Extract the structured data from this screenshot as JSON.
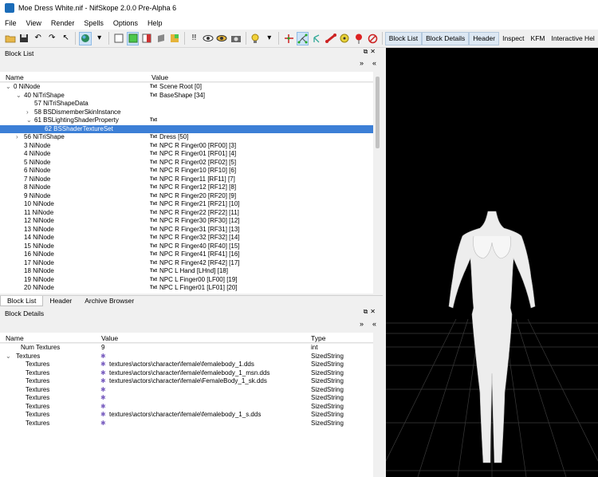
{
  "window": {
    "title": "Moe Dress White.nif - NifSkope 2.0.0 Pre-Alpha 6"
  },
  "menu": [
    "File",
    "View",
    "Render",
    "Spells",
    "Options",
    "Help"
  ],
  "toolbar": {
    "tabs": [
      {
        "label": "Block List",
        "selected": true
      },
      {
        "label": "Block Details",
        "selected": true
      },
      {
        "label": "Header",
        "selected": true
      },
      {
        "label": "Inspect",
        "selected": false
      },
      {
        "label": "KFM",
        "selected": false
      },
      {
        "label": "Interactive Hel",
        "selected": false
      }
    ]
  },
  "block_list": {
    "title": "Block List",
    "columns": [
      "Name",
      "Value"
    ],
    "rows": [
      {
        "indent": 0,
        "expander": "v",
        "name": "0 NiNode",
        "txt": "Txt",
        "value": "Scene Root [0]",
        "selected": false
      },
      {
        "indent": 1,
        "expander": "v",
        "name": "40 NiTriShape",
        "txt": "Txt",
        "value": "BaseShape [34]",
        "selected": false
      },
      {
        "indent": 2,
        "expander": "",
        "name": "57 NiTriShapeData",
        "txt": "",
        "value": "",
        "selected": false
      },
      {
        "indent": 2,
        "expander": ">",
        "name": "58 BSDismemberSkinInstance",
        "txt": "",
        "value": "",
        "selected": false
      },
      {
        "indent": 2,
        "expander": "v",
        "name": "61 BSLightingShaderProperty",
        "txt": "Txt",
        "value": "",
        "selected": false
      },
      {
        "indent": 3,
        "expander": "",
        "name": "62 BSShaderTextureSet",
        "txt": "",
        "value": "",
        "selected": true
      },
      {
        "indent": 1,
        "expander": ">",
        "name": "56 NiTriShape",
        "txt": "Txt",
        "value": "Dress [50]",
        "selected": false
      },
      {
        "indent": 1,
        "expander": "",
        "name": "3 NiNode",
        "txt": "Txt",
        "value": "NPC R Finger00 [RF00] [3]",
        "selected": false
      },
      {
        "indent": 1,
        "expander": "",
        "name": "4 NiNode",
        "txt": "Txt",
        "value": "NPC R Finger01 [RF01] [4]",
        "selected": false
      },
      {
        "indent": 1,
        "expander": "",
        "name": "5 NiNode",
        "txt": "Txt",
        "value": "NPC R Finger02 [RF02] [5]",
        "selected": false
      },
      {
        "indent": 1,
        "expander": "",
        "name": "6 NiNode",
        "txt": "Txt",
        "value": "NPC R Finger10 [RF10] [6]",
        "selected": false
      },
      {
        "indent": 1,
        "expander": "",
        "name": "7 NiNode",
        "txt": "Txt",
        "value": "NPC R Finger11 [RF11] [7]",
        "selected": false
      },
      {
        "indent": 1,
        "expander": "",
        "name": "8 NiNode",
        "txt": "Txt",
        "value": "NPC R Finger12 [RF12] [8]",
        "selected": false
      },
      {
        "indent": 1,
        "expander": "",
        "name": "9 NiNode",
        "txt": "Txt",
        "value": "NPC R Finger20 [RF20] [9]",
        "selected": false
      },
      {
        "indent": 1,
        "expander": "",
        "name": "10 NiNode",
        "txt": "Txt",
        "value": "NPC R Finger21 [RF21] [10]",
        "selected": false
      },
      {
        "indent": 1,
        "expander": "",
        "name": "11 NiNode",
        "txt": "Txt",
        "value": "NPC R Finger22 [RF22] [11]",
        "selected": false
      },
      {
        "indent": 1,
        "expander": "",
        "name": "12 NiNode",
        "txt": "Txt",
        "value": "NPC R Finger30 [RF30] [12]",
        "selected": false
      },
      {
        "indent": 1,
        "expander": "",
        "name": "13 NiNode",
        "txt": "Txt",
        "value": "NPC R Finger31 [RF31] [13]",
        "selected": false
      },
      {
        "indent": 1,
        "expander": "",
        "name": "14 NiNode",
        "txt": "Txt",
        "value": "NPC R Finger32 [RF32] [14]",
        "selected": false
      },
      {
        "indent": 1,
        "expander": "",
        "name": "15 NiNode",
        "txt": "Txt",
        "value": "NPC R Finger40 [RF40] [15]",
        "selected": false
      },
      {
        "indent": 1,
        "expander": "",
        "name": "16 NiNode",
        "txt": "Txt",
        "value": "NPC R Finger41 [RF41] [16]",
        "selected": false
      },
      {
        "indent": 1,
        "expander": "",
        "name": "17 NiNode",
        "txt": "Txt",
        "value": "NPC R Finger42 [RF42] [17]",
        "selected": false
      },
      {
        "indent": 1,
        "expander": "",
        "name": "18 NiNode",
        "txt": "Txt",
        "value": "NPC L Hand [LHnd] [18]",
        "selected": false
      },
      {
        "indent": 1,
        "expander": "",
        "name": "19 NiNode",
        "txt": "Txt",
        "value": "NPC L Finger00 [LF00] [19]",
        "selected": false
      },
      {
        "indent": 1,
        "expander": "",
        "name": "20 NiNode",
        "txt": "Txt",
        "value": "NPC L Finger01 [LF01] [20]",
        "selected": false
      }
    ]
  },
  "bottom_tabs": [
    "Block List",
    "Header",
    "Archive Browser"
  ],
  "block_details": {
    "title": "Block Details",
    "columns": [
      "Name",
      "Value",
      "Type"
    ],
    "rows": [
      {
        "indent": 1,
        "expander": "",
        "name": "Num Textures",
        "icon": false,
        "value": "9",
        "type": "int"
      },
      {
        "indent": 0,
        "expander": "v",
        "name": "Textures",
        "icon": true,
        "value": "",
        "type": "SizedString"
      },
      {
        "indent": 2,
        "expander": "",
        "name": "Textures",
        "icon": true,
        "value": "textures\\actors\\character\\female\\femalebody_1.dds",
        "type": "SizedString"
      },
      {
        "indent": 2,
        "expander": "",
        "name": "Textures",
        "icon": true,
        "value": "textures\\actors\\character\\female\\femalebody_1_msn.dds",
        "type": "SizedString"
      },
      {
        "indent": 2,
        "expander": "",
        "name": "Textures",
        "icon": true,
        "value": "textures\\actors\\character\\female\\FemaleBody_1_sk.dds",
        "type": "SizedString"
      },
      {
        "indent": 2,
        "expander": "",
        "name": "Textures",
        "icon": true,
        "value": "",
        "type": "SizedString"
      },
      {
        "indent": 2,
        "expander": "",
        "name": "Textures",
        "icon": true,
        "value": "",
        "type": "SizedString"
      },
      {
        "indent": 2,
        "expander": "",
        "name": "Textures",
        "icon": true,
        "value": "",
        "type": "SizedString"
      },
      {
        "indent": 2,
        "expander": "",
        "name": "Textures",
        "icon": true,
        "value": "textures\\actors\\character\\female\\femalebody_1_s.dds",
        "type": "SizedString"
      },
      {
        "indent": 2,
        "expander": "",
        "name": "Textures",
        "icon": true,
        "value": "",
        "type": "SizedString"
      }
    ]
  }
}
